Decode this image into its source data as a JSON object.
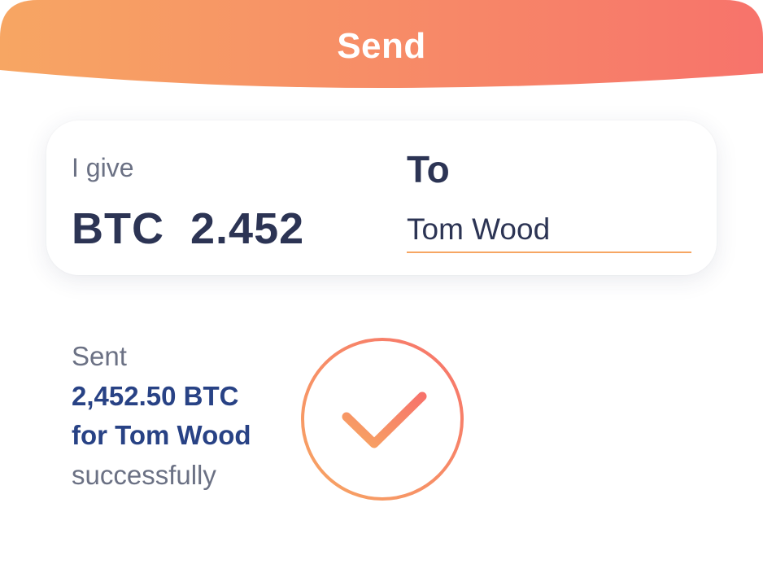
{
  "header": {
    "title": "Send",
    "gradient_start": "#f7a663",
    "gradient_end": "#f7736b"
  },
  "give": {
    "label": "I give",
    "currency": "BTC",
    "amount": "2.452"
  },
  "recipient": {
    "label": "To",
    "value": "Tom Wood"
  },
  "status": {
    "line1": "Sent",
    "line2": "2,452.50 BTC",
    "line3": "for Tom Wood",
    "line4": "successfully"
  },
  "icons": {
    "success": "checkmark-circle-icon"
  }
}
